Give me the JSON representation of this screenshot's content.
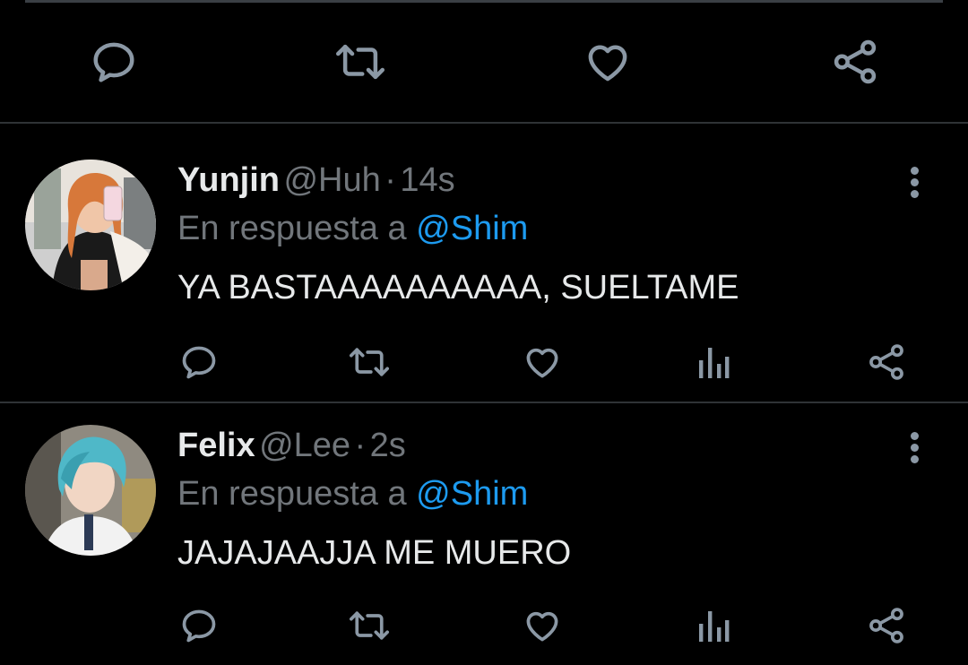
{
  "colors": {
    "accent": "#1d9bf0",
    "muted": "#71767b",
    "text": "#e7e9ea",
    "background": "#000000"
  },
  "top_actions": [
    "reply-icon",
    "retweet-icon",
    "like-icon",
    "share-icon"
  ],
  "tweets": [
    {
      "name": "Yunjin",
      "handle": "@Huh",
      "time": "14s",
      "separator": "·",
      "reply_prefix": "En respuesta a",
      "reply_to": "@Shim",
      "text": "YA BASTAAAAAAAAAA, SUELTAME",
      "actions": [
        "reply-icon",
        "retweet-icon",
        "like-icon",
        "analytics-icon",
        "share-icon"
      ]
    },
    {
      "name": "Felix",
      "handle": "@Lee",
      "time": "2s",
      "separator": "·",
      "reply_prefix": "En respuesta a",
      "reply_to": "@Shim",
      "text": "JAJAJAAJJA ME MUERO",
      "actions": [
        "reply-icon",
        "retweet-icon",
        "like-icon",
        "analytics-icon",
        "share-icon"
      ]
    }
  ]
}
